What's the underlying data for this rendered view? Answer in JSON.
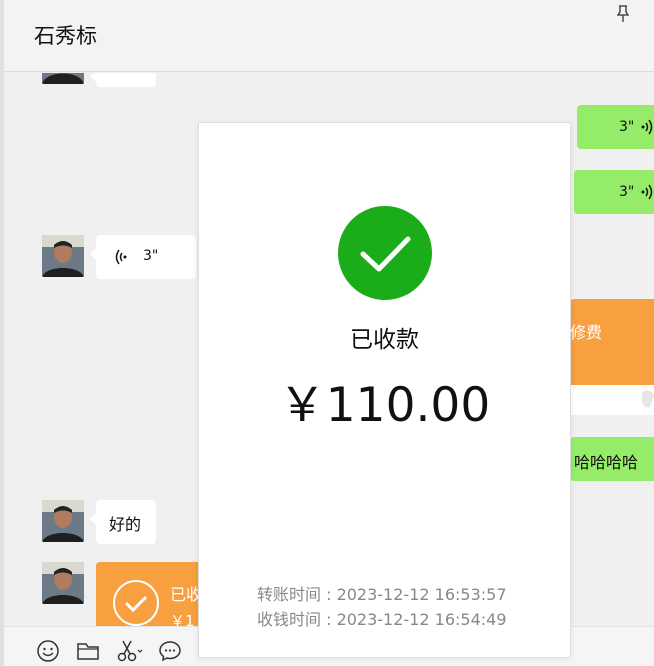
{
  "window": {
    "title": "石秀标"
  },
  "messages": {
    "voice_in": {
      "duration": "3\""
    },
    "voice_out_1": {
      "duration": "3\""
    },
    "voice_out_2": {
      "duration": "3\""
    },
    "orange_card_partial": {
      "text": "修费"
    },
    "green_partial": {
      "text": "哈哈哈哈"
    },
    "text_in": {
      "text": "好的"
    },
    "transfer_card_partial": {
      "title": "已收",
      "amount": "￥1"
    }
  },
  "modal": {
    "status": "已收款",
    "amount": "￥110.00",
    "transfer_time_label": "转账时间 : 2023-12-12 16:53:57",
    "receive_time_label": "收钱时间 : 2023-12-12 16:54:49"
  },
  "colors": {
    "accent_green": "#1aad19",
    "bubble_green": "#95ec69",
    "transfer_orange": "#f89f40"
  },
  "icons": [
    "pin-icon",
    "voice-icon",
    "check-icon",
    "emoji-icon",
    "folder-icon",
    "scissors-icon",
    "chat-history-icon"
  ]
}
